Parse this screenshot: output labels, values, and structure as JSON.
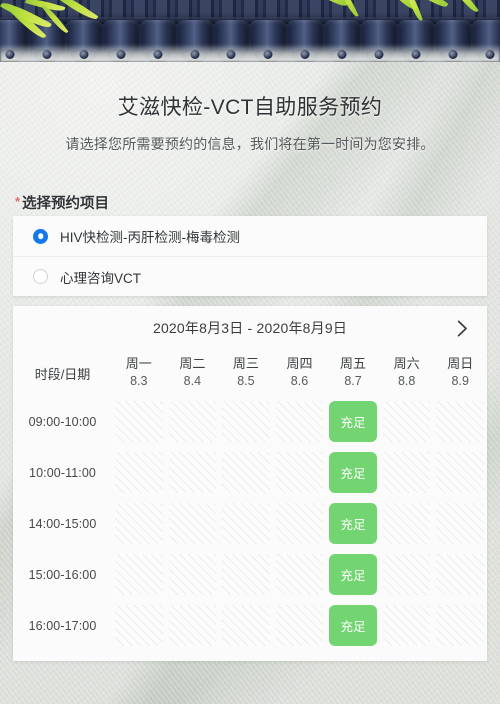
{
  "header": {
    "title": "艾滋快检-VCT自助服务预约",
    "subtitle": "请选择您所需要预约的信息，我们将在第一时间为您安排。"
  },
  "project_section": {
    "required_mark": "*",
    "label": "选择预约项目",
    "options": [
      {
        "label": "HIV快检测-丙肝检测-梅毒检测",
        "selected": true
      },
      {
        "label": "心理咨询VCT",
        "selected": false
      }
    ]
  },
  "schedule": {
    "week_range": "2020年8月3日 - 2020年8月9日",
    "next_week_icon": "chevron-right-icon",
    "corner_header": "时段/日期",
    "columns": [
      {
        "dow": "周一",
        "date": "8.3"
      },
      {
        "dow": "周二",
        "date": "8.4"
      },
      {
        "dow": "周三",
        "date": "8.5"
      },
      {
        "dow": "周四",
        "date": "8.6"
      },
      {
        "dow": "周五",
        "date": "8.7"
      },
      {
        "dow": "周六",
        "date": "8.8"
      },
      {
        "dow": "周日",
        "date": "8.9"
      }
    ],
    "available_label": "充足",
    "rows": [
      {
        "time": "09:00-10:00",
        "cells": [
          "none",
          "none",
          "none",
          "none",
          "avail",
          "none",
          "none"
        ]
      },
      {
        "time": "10:00-11:00",
        "cells": [
          "none",
          "none",
          "none",
          "none",
          "avail",
          "none",
          "none"
        ]
      },
      {
        "time": "14:00-15:00",
        "cells": [
          "none",
          "none",
          "none",
          "none",
          "avail",
          "none",
          "none"
        ]
      },
      {
        "time": "15:00-16:00",
        "cells": [
          "none",
          "none",
          "none",
          "none",
          "avail",
          "none",
          "none"
        ]
      },
      {
        "time": "16:00-17:00",
        "cells": [
          "none",
          "none",
          "none",
          "none",
          "avail",
          "none",
          "none"
        ]
      }
    ]
  },
  "colors": {
    "available_green": "#72d572",
    "radio_blue": "#1478ea",
    "required_red": "#e46a6a",
    "roof_blue": "#2a3450",
    "bamboo_green": "#c6e83f"
  }
}
